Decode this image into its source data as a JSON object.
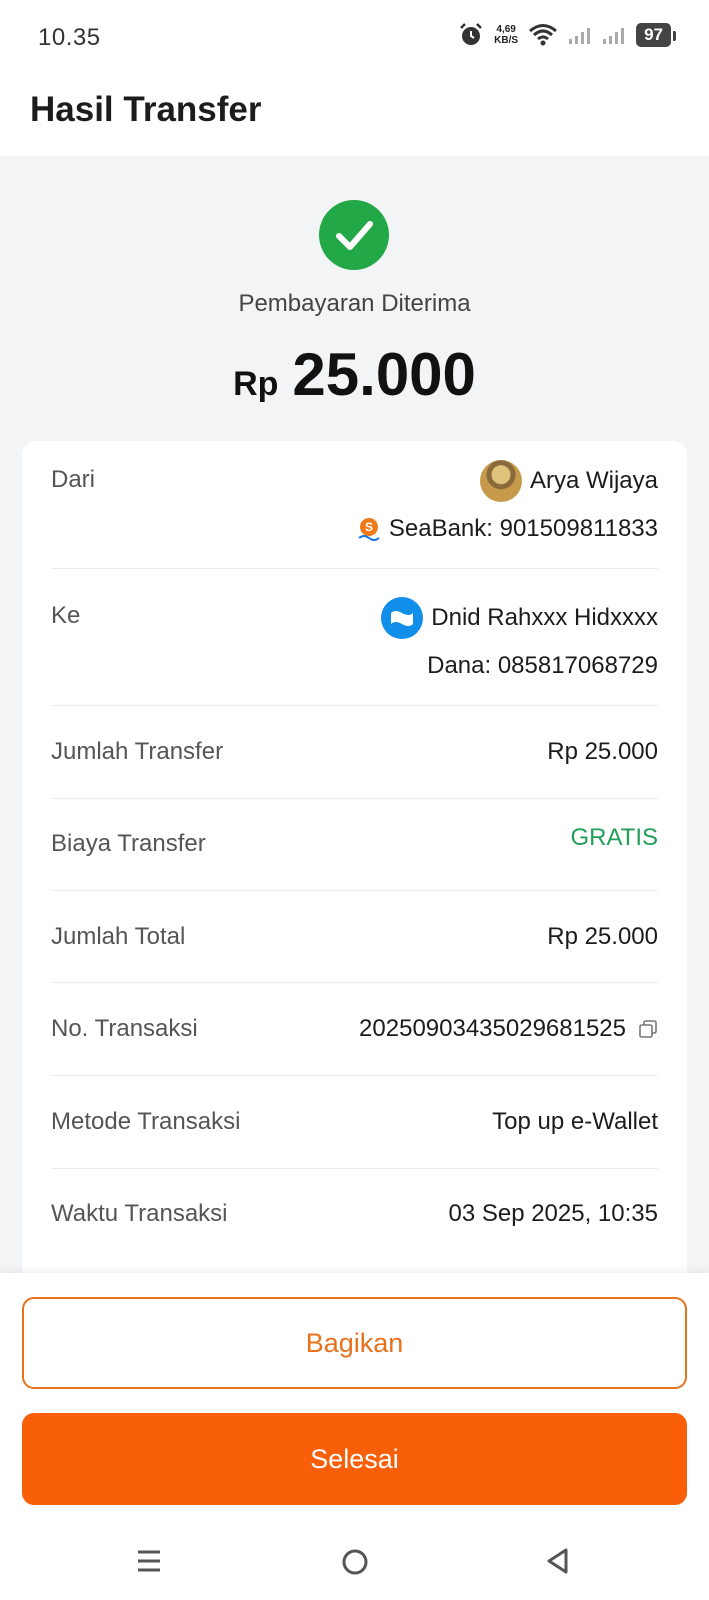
{
  "status_bar": {
    "time": "10.35",
    "net_speed_value": "4,69",
    "net_speed_unit": "KB/S",
    "battery": "97",
    "icons": [
      "alarm-icon",
      "wifi-icon",
      "signal-icon",
      "signal-icon",
      "battery-icon"
    ]
  },
  "header": {
    "title": "Hasil Transfer"
  },
  "result": {
    "status_text": "Pembayaran Diterima",
    "currency": "Rp",
    "amount": "25.000",
    "status_color": "#22a846"
  },
  "details": {
    "from": {
      "label": "Dari",
      "name": "Arya Wijaya",
      "account": "SeaBank: 901509811833"
    },
    "to": {
      "label": "Ke",
      "name": "Dnid Rahxxx Hidxxxx",
      "account": "Dana: 085817068729"
    },
    "rows": [
      {
        "label": "Jumlah Transfer",
        "value": "Rp 25.000"
      },
      {
        "label": "Biaya Transfer",
        "value": "GRATIS"
      },
      {
        "label": "Jumlah Total",
        "value": "Rp 25.000"
      },
      {
        "label": "No. Transaksi",
        "value": "20250903435029681525"
      },
      {
        "label": "Metode Transaksi",
        "value": "Top up e-Wallet"
      },
      {
        "label": "Waktu Transaksi",
        "value": "03 Sep 2025, 10:35"
      }
    ],
    "free_color": "#22a05a"
  },
  "actions": {
    "share_label": "Bagikan",
    "done_label": "Selesai",
    "accent_color": "#f95f08"
  },
  "nav": {
    "icons": [
      "menu-icon",
      "home-icon",
      "back-icon"
    ]
  }
}
